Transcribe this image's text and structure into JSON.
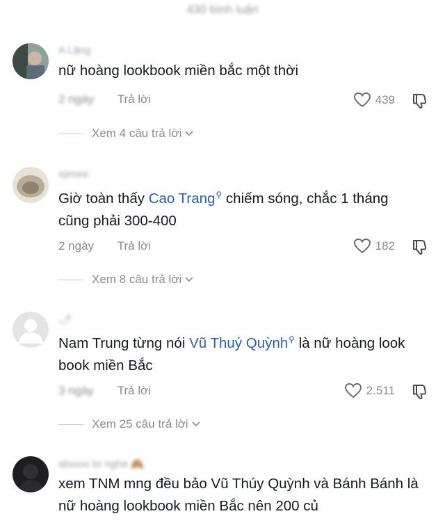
{
  "header": {
    "title": "430 bình luận"
  },
  "comments": [
    {
      "username": "A Lãng",
      "text_parts": [
        "nữ hoàng lookbook miền bắc một thời"
      ],
      "time": "2 ngày",
      "reply_label": "Trả lời",
      "likes": "439",
      "view_replies": "Xem 4 câu trả lời"
    },
    {
      "username": "xjimee",
      "text_before": "Giờ toàn thấy ",
      "mention": "Cao Trang",
      "text_after": " chiếm sóng, chắc 1 tháng cũng phải 300-400",
      "time": "2 ngày",
      "reply_label": "Trả lời",
      "likes": "182",
      "view_replies": "Xem 8 câu trả lời"
    },
    {
      "username": "🌶",
      "text_before": "Nam Trung từng nói ",
      "mention": "Vũ Thuý Quỳnh",
      "text_after": " là nữ hoàng look book miền Bắc",
      "time": "3 ngày",
      "reply_label": "Trả lời",
      "likes": "2.511",
      "view_replies": "Xem 25 câu trả lời"
    },
    {
      "username": "aloooo lơ nghe 🙈",
      "text": "xem TNM mng đều bảo Vũ Thúy Quỳnh và Bánh Bánh là nữ hoàng lookbook miền Bắc nên 200 củ"
    }
  ],
  "icons": {
    "like": "heart-outline-icon",
    "dislike": "thumbs-down-icon",
    "mention": "search-icon",
    "expand": "chevron-down-icon"
  },
  "colors": {
    "mention": "#2b5db8",
    "meta": "#8a8b91",
    "text": "#161823"
  }
}
